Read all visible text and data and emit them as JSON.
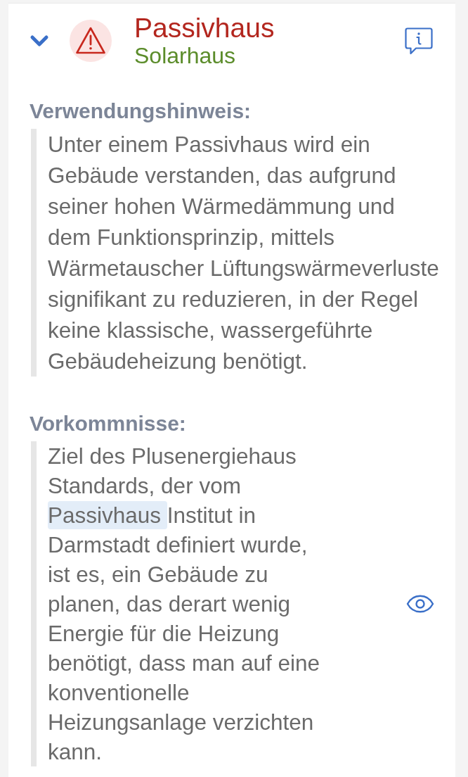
{
  "entry": {
    "expanded": true,
    "title": "Passivhaus",
    "subtitle": "Solarhaus"
  },
  "sections": [
    {
      "kind": "plain",
      "heading": "Verwendungshinweis:",
      "segments": [
        {
          "text": "Unter einem Passivhaus wird ein Gebäude verstanden, das aufgrund seiner hohen Wärmedämmung und dem Funktionsprinzip, mittels Wärmetauscher Lüftungswärmeverluste signifikant zu reduzieren, in der Regel keine klassische, wassergeführte Gebäudeheizung benötigt.",
          "highlighted": false
        }
      ]
    },
    {
      "kind": "viewable",
      "heading": "Vorkommnisse:",
      "segments": [
        {
          "text": "Ziel des Plusenergiehaus Standards, der vom ",
          "highlighted": false
        },
        {
          "text": "Passivhaus ",
          "highlighted": true
        },
        {
          "text": "Institut in Darmstadt definiert wurde, ist es, ein Gebäude zu planen, das derart wenig Energie für die Heizung benötigt, dass man auf eine konventionelle Heizungsanlage verzichten kann.",
          "highlighted": false
        }
      ]
    }
  ]
}
